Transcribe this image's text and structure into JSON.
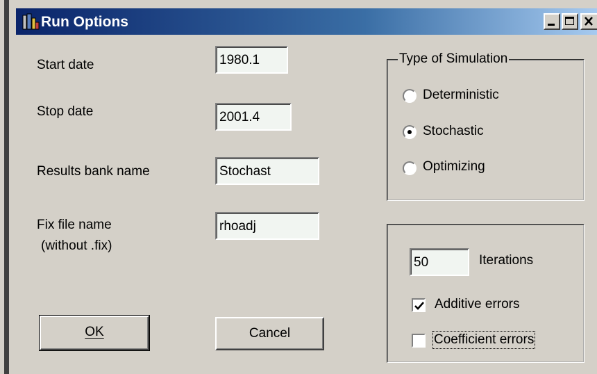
{
  "window": {
    "title": "Run Options"
  },
  "form": {
    "start_date_label": "Start date",
    "start_date_value": "1980.1",
    "stop_date_label": "Stop date",
    "stop_date_value": "2001.4",
    "results_bank_label": "Results bank name",
    "results_bank_value": "Stochast",
    "fix_file_label": "Fix file name",
    "fix_file_sublabel": "(without .fix)",
    "fix_file_value": "rhoadj"
  },
  "simulation": {
    "group_title": "Type of Simulation",
    "options": [
      {
        "label": "Deterministic",
        "selected": false
      },
      {
        "label": "Stochastic",
        "selected": true
      },
      {
        "label": "Optimizing",
        "selected": false
      }
    ]
  },
  "stochastic": {
    "iterations_value": "50",
    "iterations_label": "Iterations",
    "additive_errors_label": "Additive errors",
    "additive_errors_checked": true,
    "coefficient_errors_label": "Coefficient errors",
    "coefficient_errors_checked": false
  },
  "buttons": {
    "ok_label": "OK",
    "cancel_label": "Cancel"
  },
  "colors": {
    "titlebar_start": "#0a246a",
    "titlebar_end": "#a6caf0",
    "face": "#d4d0c8"
  }
}
